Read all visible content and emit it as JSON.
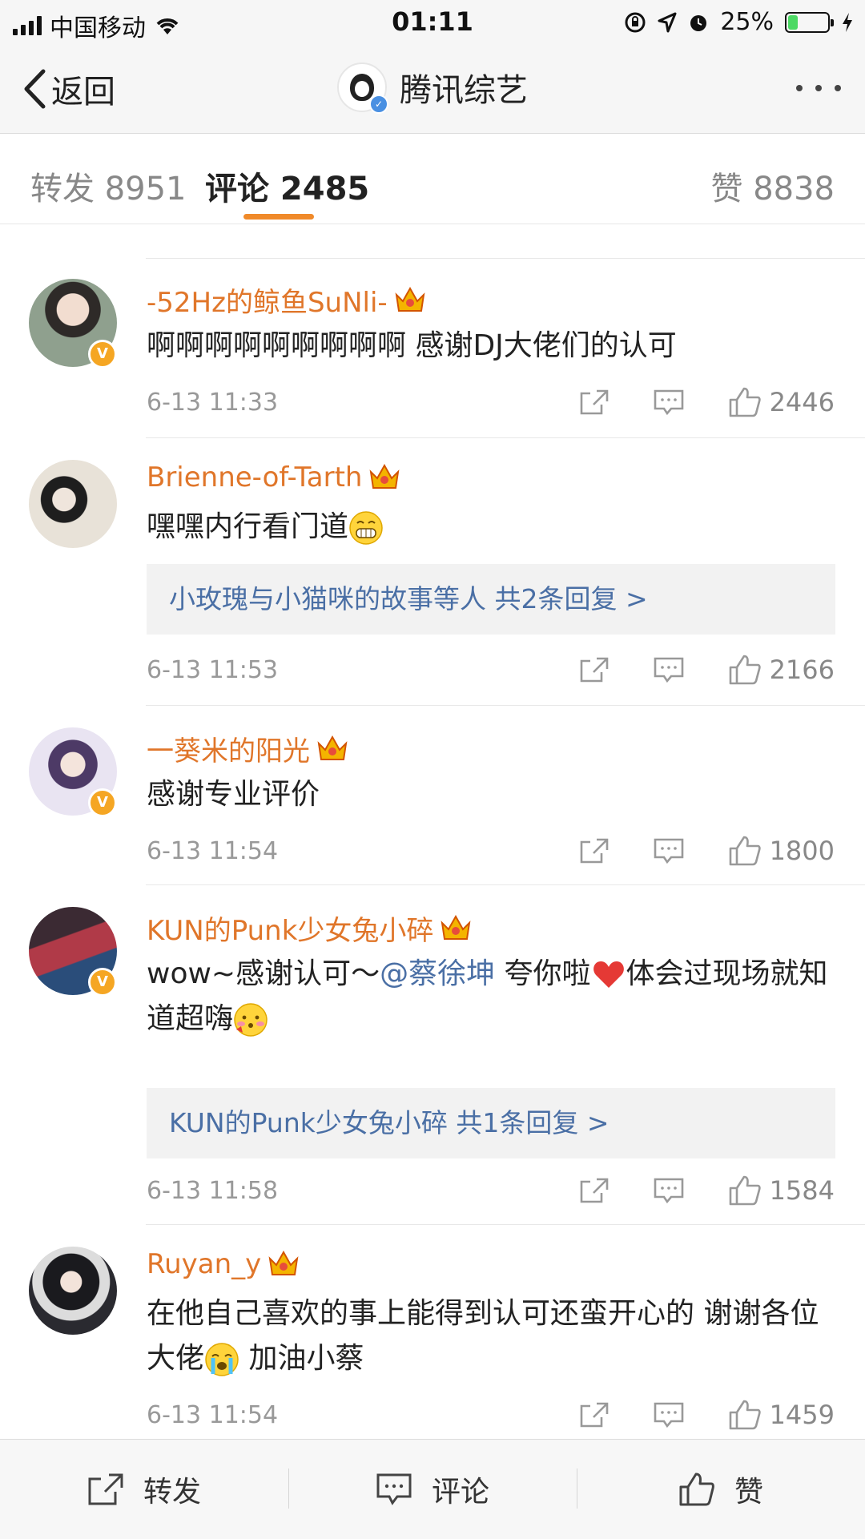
{
  "status_bar": {
    "carrier": "中国移动",
    "time": "01:11",
    "battery": "25%",
    "battery_level": 0.25
  },
  "nav": {
    "back_label": "返回",
    "title": "腾讯综艺"
  },
  "tabs": {
    "repost": "转发 8951",
    "comment": "评论 2485",
    "like": "赞 8838"
  },
  "comments": [
    {
      "user": "-52Hz的鲸鱼SuNli-",
      "text": "啊啊啊啊啊啊啊啊啊 感谢DJ大佬们的认可",
      "time": "6-13 11:33",
      "likes": "2446",
      "avatar_color": "#5b6a60"
    },
    {
      "user": "Brienne-of-Tarth",
      "text": "嘿嘿内行看门道",
      "reply": "小玫瑰与小猫咪的故事等人  共2条回复 >",
      "time": "6-13 11:53",
      "likes": "2166",
      "avatar_color": "#3d4a44"
    },
    {
      "user": "一葵米的阳光",
      "text": "感谢专业评价",
      "time": "6-13 11:54",
      "likes": "1800",
      "avatar_color": "#6c5a7a"
    },
    {
      "user": "KUN的Punk少女兔小碎",
      "text_before": "wow~感谢认可～",
      "mention": "@蔡徐坤",
      "text_after": " 夸你啦",
      "text_after2": "体会过现场就知道超嗨",
      "reply": "KUN的Punk少女兔小碎  共1条回复 >",
      "time": "6-13 11:58",
      "likes": "1584",
      "avatar_color": "#8a3b45"
    },
    {
      "user": "Ruyan_y",
      "text_before": "在他自己喜欢的事上能得到认可还蛮开心的 谢谢各位大佬",
      "text_after": " 加油小蔡",
      "time": "6-13 11:54",
      "likes": "1459",
      "avatar_color": "#2c2a30"
    }
  ],
  "bottom_bar": {
    "repost": "转发",
    "comment": "评论",
    "like": "赞"
  },
  "colors": {
    "username": "#e0762a",
    "link": "#4a6fa5",
    "accent": "#f08a2a"
  }
}
